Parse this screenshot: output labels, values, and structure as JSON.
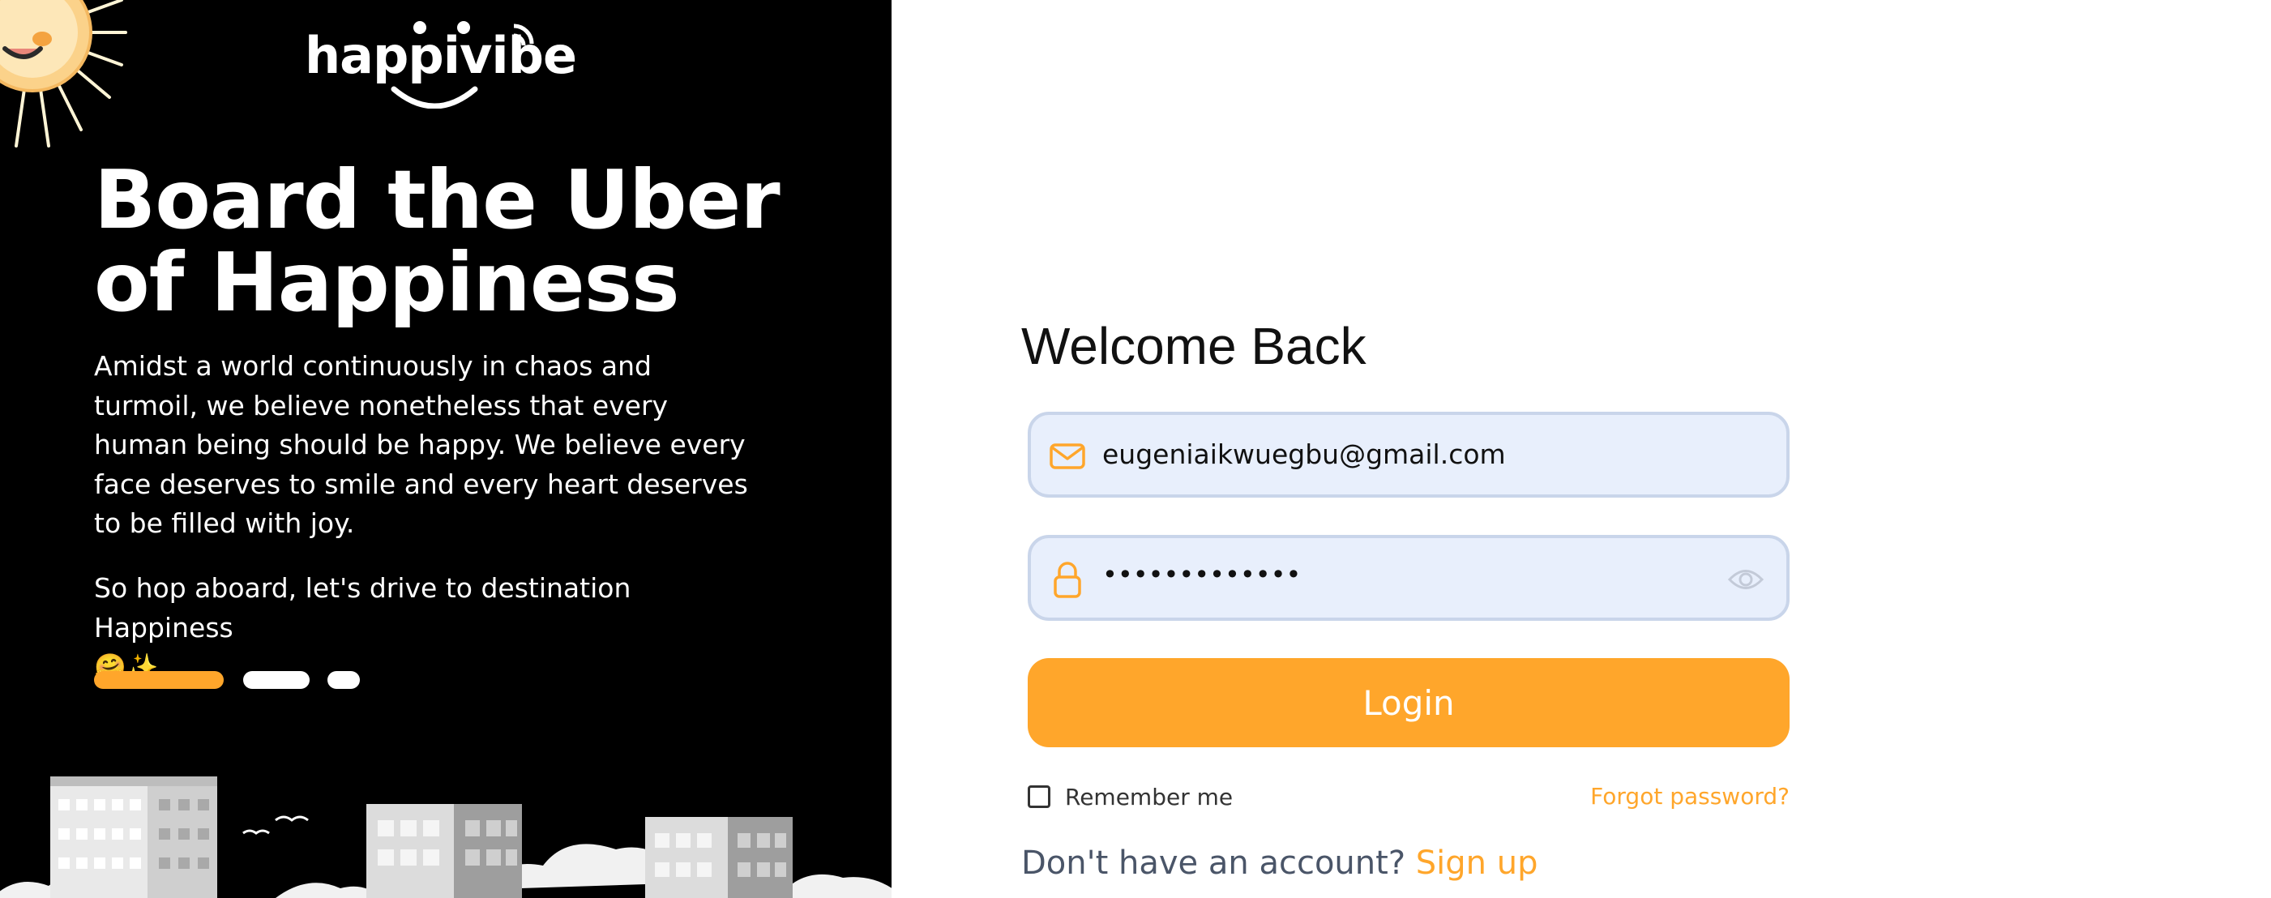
{
  "brand": {
    "logo_text": "happivibe",
    "accent_color": "#ffa62b"
  },
  "hero": {
    "headline": "Board the Uber of Happiness",
    "paragraph1": "Amidst a world continuously in chaos and turmoil, we believe nonetheless that every human being should be happy. We believe every face deserves to smile and every heart deserves to be filled with joy.",
    "paragraph2": "So hop aboard, let's drive to destination Happiness",
    "emoji": "🤗✨",
    "carousel": {
      "slides": 3,
      "active": 1
    }
  },
  "login": {
    "title": "Welcome Back",
    "email": {
      "value": "eugeniaikwuegbu@gmail.com",
      "icon": "mail-icon"
    },
    "password": {
      "value": "•••••••••••••",
      "icon": "lock-icon",
      "toggle_icon": "eye-icon"
    },
    "submit_label": "Login",
    "remember_label": "Remember me",
    "remember_checked": false,
    "forgot_label": "Forgot password?",
    "signup_prompt": "Don't have an account?",
    "signup_link": "Sign up"
  }
}
